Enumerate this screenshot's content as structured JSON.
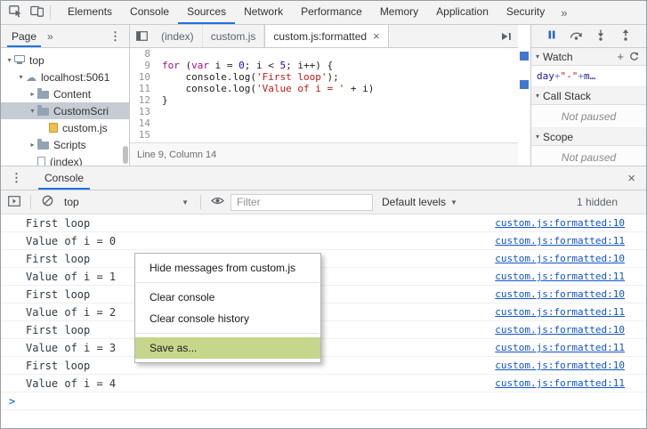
{
  "colors": {
    "accent": "#1a73e8",
    "toolbar_bg": "#f3f3f3",
    "selection_bg": "#c5ccd3",
    "menu_highlight": "#c6d68a",
    "link": "#1155cc",
    "keyword": "#aa0d91",
    "number": "#1c00cf",
    "string": "#c41a16"
  },
  "icons": {
    "inspect": "cursor-in-box",
    "device_toolbar": "phone-tablet",
    "more_tabs": "»",
    "menu_dots": "⋮",
    "close": "×",
    "expand": "▾",
    "collapse": "▸",
    "dropdown": "▼",
    "cloud": "☁",
    "add_watch": "+",
    "refresh": "circular-arrow",
    "pause": "pause-bars",
    "step_over": "curved-arrow",
    "step_into": "arrow-down-to-dot",
    "step_out": "arrow-up-from-dot",
    "console_sidebar": "play-in-box",
    "clear_console": "circle-slash",
    "eye": "eye",
    "navigator_toggle": "half-filled-square",
    "editor_overflow": "play-bar"
  },
  "main_toolbar": {
    "tabs": [
      "Elements",
      "Console",
      "Sources",
      "Network",
      "Performance",
      "Memory",
      "Application",
      "Security"
    ],
    "active_tab": "Sources"
  },
  "sidebar": {
    "header": {
      "tab": "Page"
    },
    "tree": [
      {
        "label": "top",
        "icon": "computer",
        "depth": 0,
        "expanded": true
      },
      {
        "label": "localhost:5061",
        "icon": "cloud",
        "depth": 1,
        "expanded": true
      },
      {
        "label": "Content",
        "icon": "folder",
        "depth": 2,
        "expanded": false
      },
      {
        "label": "CustomScri",
        "icon": "folder",
        "depth": 2,
        "expanded": true,
        "selected": true
      },
      {
        "label": "custom.js",
        "icon": "file-js",
        "depth": 3
      },
      {
        "label": "Scripts",
        "icon": "folder",
        "depth": 2,
        "expanded": false
      },
      {
        "label": "(index)",
        "icon": "file",
        "depth": 2
      }
    ]
  },
  "editor": {
    "tabs": [
      {
        "label": "(index)"
      },
      {
        "label": "custom.js"
      },
      {
        "label": "custom.js:formatted",
        "active": true
      }
    ],
    "lines": [
      {
        "num": 8,
        "code": []
      },
      {
        "num": 9,
        "code": [
          {
            "t": "kw",
            "v": "for"
          },
          {
            "t": "plain",
            "v": " ("
          },
          {
            "t": "kw",
            "v": "var"
          },
          {
            "t": "plain",
            "v": " i = "
          },
          {
            "t": "num",
            "v": "0"
          },
          {
            "t": "plain",
            "v": "; i < "
          },
          {
            "t": "num",
            "v": "5"
          },
          {
            "t": "plain",
            "v": "; i++) {"
          }
        ]
      },
      {
        "num": 10,
        "code": [
          {
            "t": "plain",
            "v": "    console.log("
          },
          {
            "t": "str",
            "v": "'First loop'"
          },
          {
            "t": "plain",
            "v": ");"
          }
        ]
      },
      {
        "num": 11,
        "code": [
          {
            "t": "plain",
            "v": "    console.log("
          },
          {
            "t": "str",
            "v": "'Value of i = '"
          },
          {
            "t": "plain",
            "v": " + i)"
          }
        ]
      },
      {
        "num": 12,
        "code": [
          {
            "t": "plain",
            "v": "}"
          }
        ]
      },
      {
        "num": 13,
        "code": []
      },
      {
        "num": 14,
        "code": []
      },
      {
        "num": 15,
        "code": []
      }
    ],
    "status": "Line 9, Column 14"
  },
  "debugger_pane": {
    "watch": {
      "title": "Watch",
      "expression_tokens": [
        {
          "t": "id",
          "v": "day"
        },
        {
          "t": "op",
          "v": " + "
        },
        {
          "t": "str",
          "v": "\"-\""
        },
        {
          "t": "op",
          "v": " + "
        },
        {
          "t": "id",
          "v": "m…"
        }
      ]
    },
    "call_stack": {
      "title": "Call Stack",
      "message": "Not paused"
    },
    "scope": {
      "title": "Scope",
      "message": "Not paused"
    }
  },
  "console_drawer": {
    "tab": "Console",
    "toolbar": {
      "context": "top",
      "filter_placeholder": "Filter",
      "levels": "Default levels",
      "hidden_count": "1 hidden"
    },
    "messages": [
      {
        "text": "First loop",
        "source": "custom.js:formatted:10"
      },
      {
        "text": "Value of i = 0",
        "source": "custom.js:formatted:11"
      },
      {
        "text": "First loop",
        "source": "custom.js:formatted:10"
      },
      {
        "text": "Value of i = 1",
        "source": "custom.js:formatted:11"
      },
      {
        "text": "First loop",
        "source": "custom.js:formatted:10"
      },
      {
        "text": "Value of i = 2",
        "source": "custom.js:formatted:11"
      },
      {
        "text": "First loop",
        "source": "custom.js:formatted:10"
      },
      {
        "text": "Value of i = 3",
        "source": "custom.js:formatted:11"
      },
      {
        "text": "First loop",
        "source": "custom.js:formatted:10"
      },
      {
        "text": "Value of i = 4",
        "source": "custom.js:formatted:11"
      }
    ],
    "prompt": ">"
  },
  "context_menu": {
    "items": [
      {
        "label": "Hide messages from custom.js"
      },
      {
        "type": "separator"
      },
      {
        "label": "Clear console"
      },
      {
        "label": "Clear console history"
      },
      {
        "type": "separator"
      },
      {
        "label": "Save as...",
        "highlighted": true
      }
    ]
  }
}
